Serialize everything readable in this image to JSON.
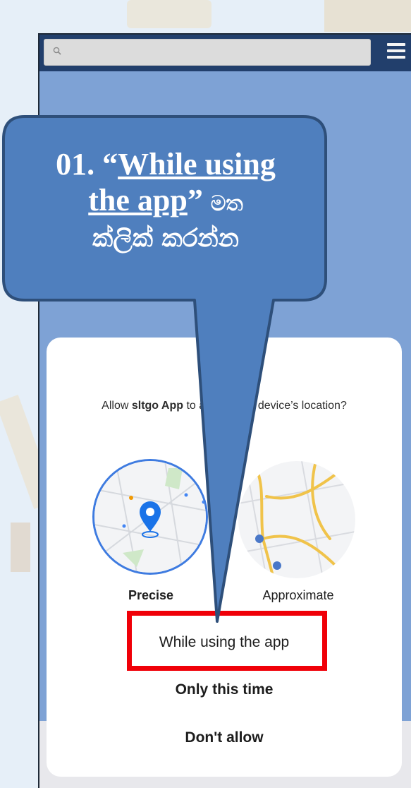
{
  "search": {
    "placeholder": ""
  },
  "callout": {
    "step_prefix": "01. “",
    "highlight_part1": "While using",
    "highlight_part2": "the app",
    "close_quote": "” ",
    "sinhala_suffix": "මත",
    "line3": "ක්‍ලික් කරන්න"
  },
  "dialog": {
    "prompt_prefix": "Allow ",
    "prompt_app": "sltgo App",
    "prompt_suffix": " to access this device’s location?",
    "precise_label": "Precise",
    "approximate_label": "Approximate",
    "choices": [
      "While using the app",
      "Only this time",
      "Don't allow"
    ]
  },
  "colors": {
    "callout_fill": "#4f7fbe",
    "callout_border": "#2e4f7a",
    "highlight": "#f00008",
    "accent": "#1a73e8"
  },
  "icons": [
    "search-icon",
    "hamburger-menu-icon",
    "location-pin-icon"
  ]
}
